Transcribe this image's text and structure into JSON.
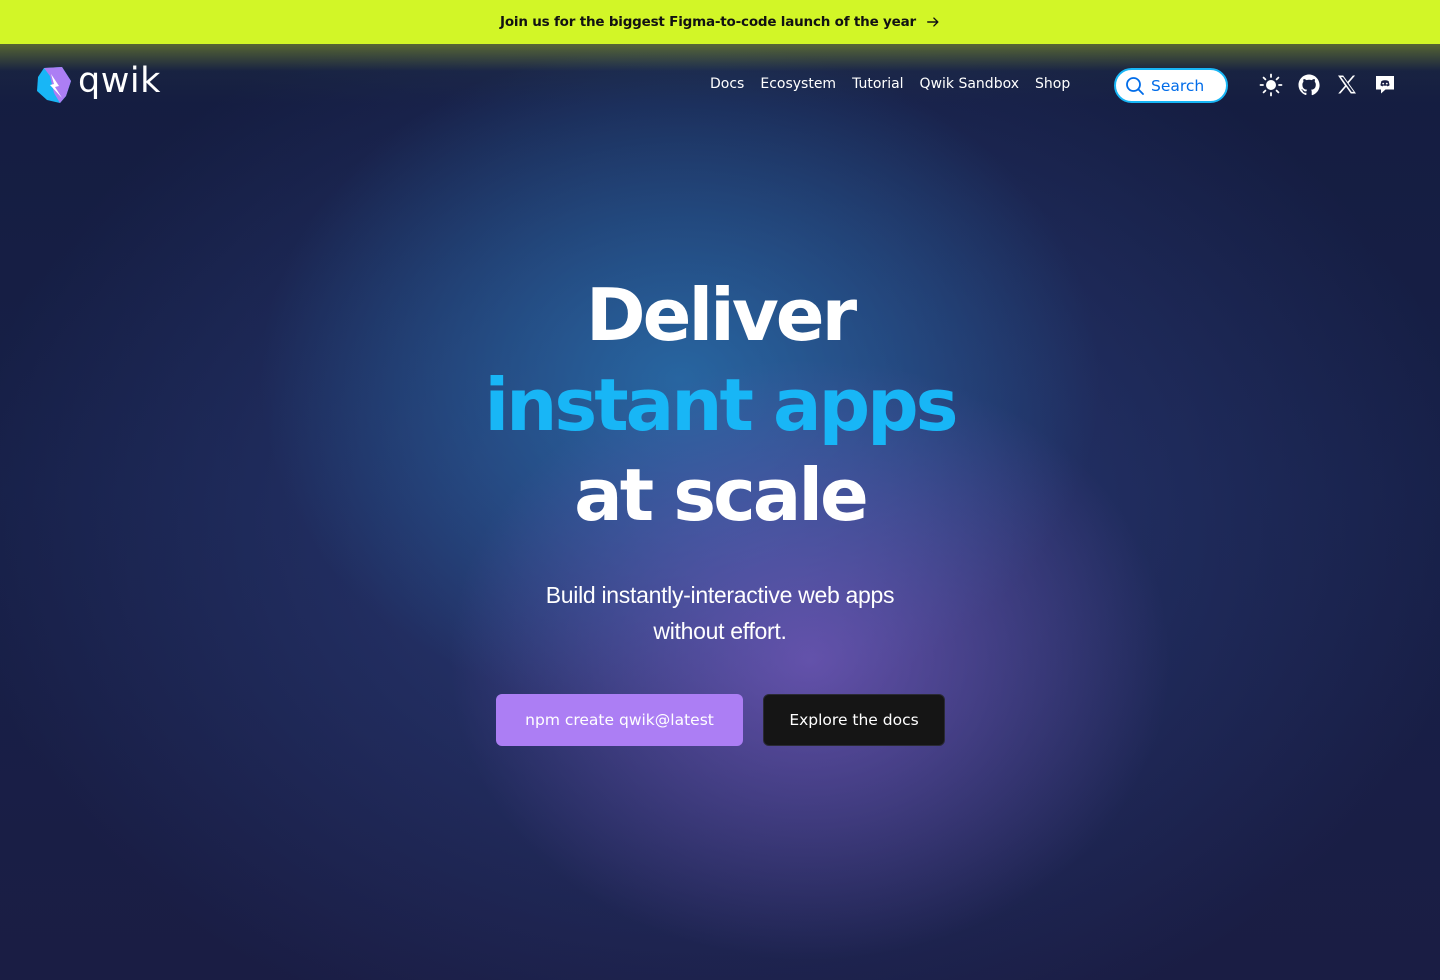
{
  "banner": {
    "text": "Join us for the biggest Figma-to-code launch of the year",
    "icon": "arrow-right-icon",
    "background_color": "#d2f627"
  },
  "header": {
    "logo_text": "qwik",
    "nav_items": [
      {
        "label": "Docs"
      },
      {
        "label": "Ecosystem"
      },
      {
        "label": "Tutorial"
      },
      {
        "label": "Qwik Sandbox"
      },
      {
        "label": "Shop"
      }
    ],
    "search_label": "Search",
    "icons": [
      "sun-icon",
      "github-icon",
      "x-twitter-icon",
      "discord-icon"
    ]
  },
  "hero": {
    "line1": "Deliver",
    "line2": "instant apps",
    "line3": "at scale",
    "subtitle_line1": "Build instantly-interactive web apps",
    "subtitle_line2": "without effort.",
    "accent_color": "#18b6f6"
  },
  "cta": {
    "primary_label": "npm create qwik@latest",
    "primary_color": "#ac7ef4",
    "secondary_label": "Explore the docs",
    "secondary_color": "#151515"
  }
}
